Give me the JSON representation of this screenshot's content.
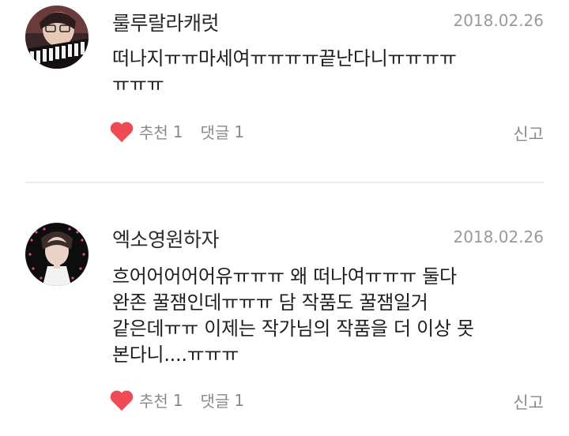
{
  "comments": [
    {
      "username": "룰루랄라캐럿",
      "date": "2018.02.26",
      "text": "떠나지ㅠㅠ마세여ㅠㅠㅠㅠ끝난다니ㅠㅠㅠㅠ\nㅠㅠㅠ",
      "like_label": "추천",
      "like_count": "1",
      "reply_label": "댓글",
      "reply_count": "1",
      "report_label": "신고"
    },
    {
      "username": "엑소영원하자",
      "date": "2018.02.26",
      "text": "흐어어어어어유ㅠㅠㅠ 왜 떠나여ㅠㅠㅠ 둘다\n완존 꿀잼인데ㅠㅠㅠ 담 작품도 꿀잼일거\n같은데ㅠㅠ 이제는 작가님의 작품을 더 이상 못\n본다니....ㅠㅠㅠ",
      "like_label": "추천",
      "like_count": "1",
      "reply_label": "댓글",
      "reply_count": "1",
      "report_label": "신고"
    }
  ],
  "colors": {
    "heart": "#ef4b55",
    "meta_text": "#8a8a8a",
    "date_text": "#9a9a9a",
    "divider": "#e8eef0"
  }
}
